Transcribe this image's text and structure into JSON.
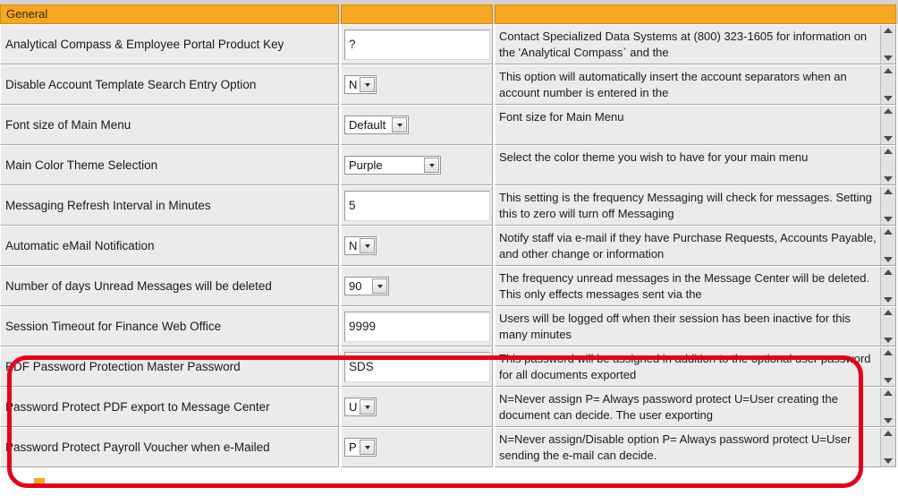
{
  "header": {
    "group_label": "General",
    "accent_color": "#f5a623"
  },
  "annotation": {
    "highlight_color": "#e3021b",
    "marker_color": "#f5a623"
  },
  "icons": {
    "scroll_up": "scroll-up-arrow-icon",
    "scroll_down": "scroll-down-arrow-icon",
    "dropdown": "chevron-down-icon"
  },
  "rows": [
    {
      "label": "Analytical Compass & Employee Portal Product Key",
      "control": "text",
      "value": "?",
      "width": "full",
      "description": "Contact Specialized Data Systems at (800) 323-1605 for information on the 'Analytical Compass` and the"
    },
    {
      "label": "Disable Account Template Search Entry Option",
      "control": "dropdown",
      "value": "N",
      "width": "w-xs",
      "description": "This option will automatically insert the account separators when an account number is entered in the"
    },
    {
      "label": "Font size of Main Menu",
      "control": "dropdown",
      "value": "Default",
      "width": "w-md",
      "description": "Font size for Main Menu"
    },
    {
      "label": "Main Color Theme Selection",
      "control": "dropdown",
      "value": "Purple",
      "width": "w-lg",
      "description": "Select the color theme you wish to have for your main menu"
    },
    {
      "label": "Messaging Refresh Interval in Minutes",
      "control": "text",
      "value": "5",
      "width": "full",
      "description": "This setting is the frequency Messaging will check for messages.  Setting this to zero will turn off Messaging"
    },
    {
      "label": "Automatic eMail Notification",
      "control": "dropdown",
      "value": "N",
      "width": "w-xs",
      "description": "Notify staff via e-mail if they have Purchase Requests, Accounts Payable, and other change or information"
    },
    {
      "label": "Number of days Unread Messages will be deleted",
      "control": "dropdown",
      "value": "90",
      "width": "w-sm",
      "description": "The frequency unread messages in the Message Center will be deleted.  This only effects messages sent via the"
    },
    {
      "label": "Session Timeout for Finance Web Office",
      "control": "text",
      "value": "9999",
      "width": "full",
      "description": "Users will be logged off when their session has been inactive for this many minutes"
    },
    {
      "label": "PDF Password Protection Master Password",
      "control": "text",
      "value": "SDS",
      "width": "full",
      "description": "This password will be assigned in addition to the optional user password for all documents exported"
    },
    {
      "label": "Password Protect PDF export to Message Center",
      "control": "dropdown",
      "value": "U",
      "width": "w-xs",
      "description": "N=Never assign P= Always password protect U=User creating the document can decide.  The user exporting"
    },
    {
      "label": "Password Protect Payroll Voucher when e-Mailed",
      "control": "dropdown",
      "value": "P",
      "width": "w-xs",
      "description": "N=Never assign/Disable option P= Always password protect U=User sending the e-mail can decide."
    }
  ]
}
